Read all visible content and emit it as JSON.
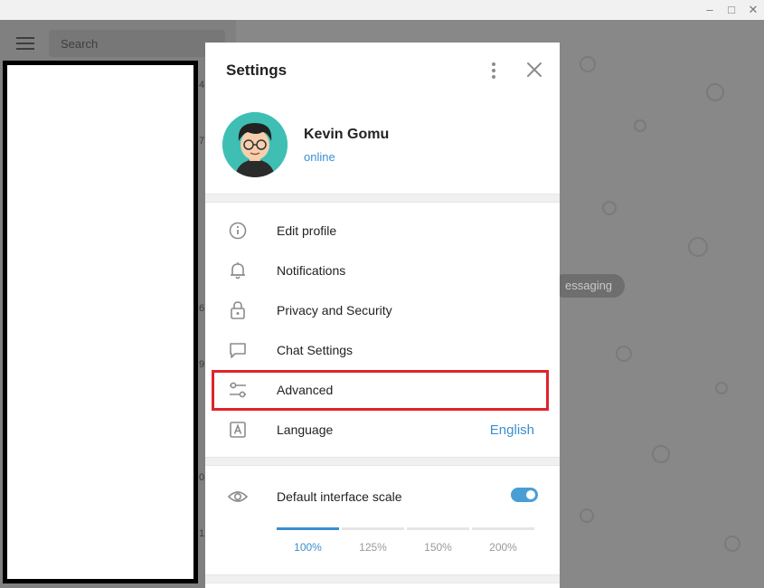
{
  "window": {
    "minimize_glyph": "–",
    "maximize_glyph": "□",
    "close_glyph": "✕"
  },
  "sidebar": {
    "search_placeholder": "Search",
    "peek_chars": [
      "4",
      "7",
      "6",
      "9",
      "0",
      "1"
    ]
  },
  "chat": {
    "service_message": "essaging"
  },
  "settings": {
    "title": "Settings",
    "profile": {
      "name": "Kevin Gomu",
      "status": "online"
    },
    "menu": [
      {
        "label": "Edit profile",
        "icon": "info-icon"
      },
      {
        "label": "Notifications",
        "icon": "bell-icon"
      },
      {
        "label": "Privacy and Security",
        "icon": "lock-icon"
      },
      {
        "label": "Chat Settings",
        "icon": "chat-bubble-icon"
      },
      {
        "label": "Advanced",
        "icon": "sliders-icon"
      },
      {
        "label": "Language",
        "icon": "language-icon",
        "value": "English"
      }
    ],
    "scale": {
      "label": "Default interface scale",
      "enabled": true,
      "options": [
        "100%",
        "125%",
        "150%",
        "200%"
      ],
      "selected": "100%"
    }
  },
  "colors": {
    "accent": "#3a8fd0",
    "highlight": "#e0232b",
    "avatar_bg": "#3fbfb3"
  }
}
